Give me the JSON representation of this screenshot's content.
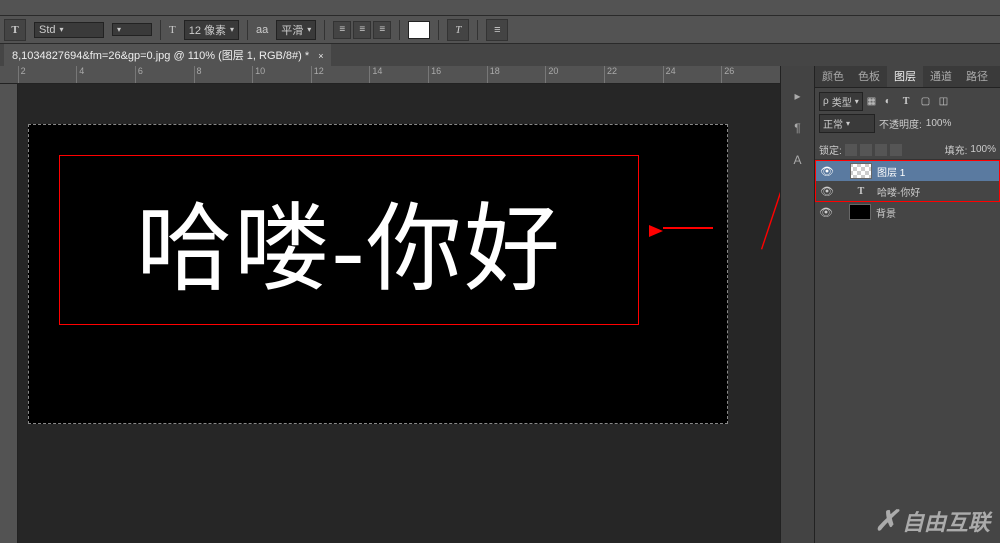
{
  "optbar": {
    "tool_glyph": "T",
    "font_family": "Std",
    "font_size_prefix": "T",
    "font_size": "12 像素",
    "aa_glyph": "aa",
    "antialias": "平滑",
    "color": "#ffffff",
    "warp_glyph": "T",
    "menu_glyph": "≡"
  },
  "doc": {
    "title": "8,1034827694&fm=26&gp=0.jpg @ 110% (图层 1, RGB/8#) *",
    "close": "×"
  },
  "ruler": {
    "h": [
      "2",
      "4",
      "6",
      "8",
      "10",
      "12",
      "14",
      "16",
      "18",
      "20",
      "22",
      "24",
      "26"
    ],
    "v": [
      "",
      "",
      "",
      "",
      "",
      ""
    ]
  },
  "canvas_text": "哈喽-你好",
  "panel": {
    "tabs": [
      "颜色",
      "色板",
      "图层",
      "通道",
      "路径"
    ],
    "active_tab_index": 2,
    "type_filter": "类型",
    "search_icon": "ρ",
    "blend": "正常",
    "opacity_label": "不透明度:",
    "opacity": "100%",
    "lock_label": "锁定:",
    "fill_label": "填充:",
    "fill": "100%"
  },
  "layers": [
    {
      "name": "图层 1",
      "type": "raster",
      "selected": true
    },
    {
      "name": "哈喽-你好",
      "type": "text",
      "selected": false
    },
    {
      "name": "背景",
      "type": "bg",
      "selected": false
    }
  ],
  "watermark": "自由互联"
}
